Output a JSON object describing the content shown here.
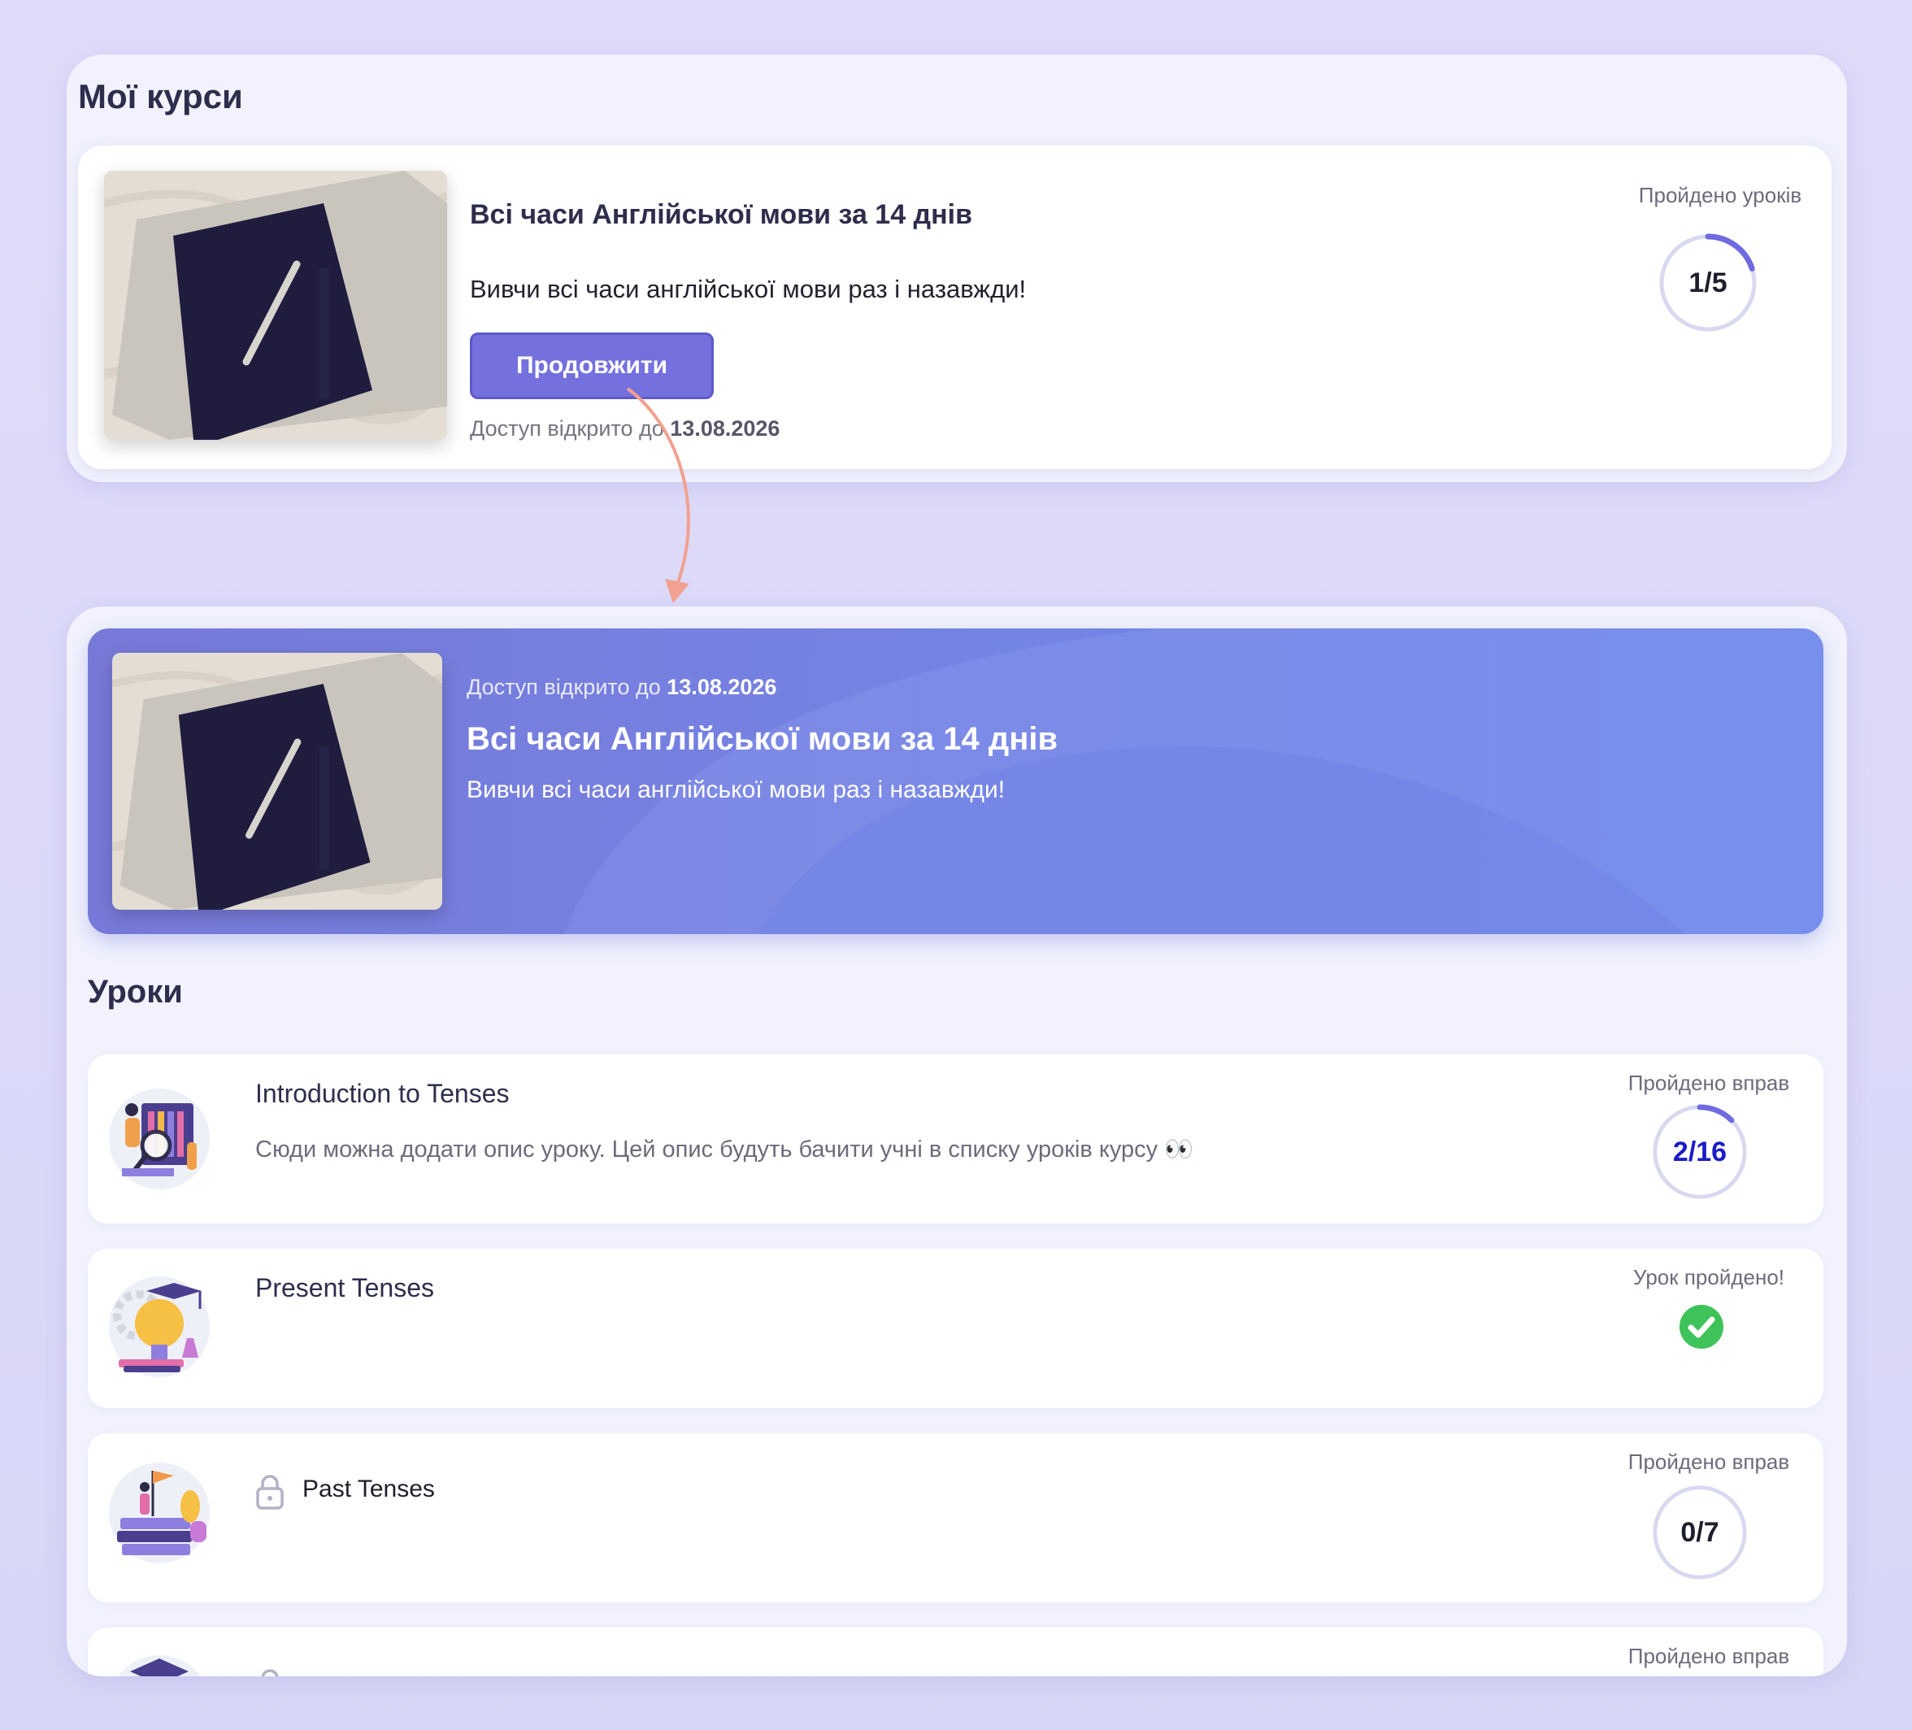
{
  "my_courses": {
    "title": "Мої курси",
    "course": {
      "title": "Всі часи Англійської мови за 14 днів",
      "description": "Вивчи всі часи англійської мови раз і назавжди!",
      "continue_label": "Продовжити",
      "access_prefix": "Доступ відкрито до",
      "access_date": "13.08.2026",
      "progress_label": "Пройдено уроків",
      "progress_text": "1/5",
      "progress_fraction": 0.2
    }
  },
  "course_page": {
    "hero": {
      "access_prefix": "Доступ відкрито до",
      "access_date": "13.08.2026",
      "title": "Всі часи Англійської мови за 14 днів",
      "description": "Вивчи всі часи англійської мови раз і назавжди!"
    },
    "lessons_title": "Уроки",
    "lessons": [
      {
        "title": "Introduction to Tenses",
        "description": "Сюди можна додати опис уроку. Цей опис будуть бачити учні в списку уроків курсу 👀",
        "status_label": "Пройдено вправ",
        "progress_text": "2/16",
        "progress_fraction": 0.125,
        "icon": "research-illustration"
      },
      {
        "title": "Present Tenses",
        "status_label": "Урок пройдено!",
        "completed": true,
        "icon": "lightbulb-graduation-illustration"
      },
      {
        "title": "Past Tenses",
        "locked": true,
        "status_label": "Пройдено вправ",
        "progress_text": "0/7",
        "progress_fraction": 0,
        "icon": "books-flag-illustration"
      },
      {
        "status_label": "Пройдено вправ",
        "locked": true,
        "icon": "graduation-cap-illustration"
      }
    ]
  },
  "colors": {
    "accent": "#7470de",
    "ring_track": "#dad8ef",
    "ring_progress": "#6f6ae0",
    "success": "#3ec35a",
    "annotation_arrow": "#f2a090"
  }
}
